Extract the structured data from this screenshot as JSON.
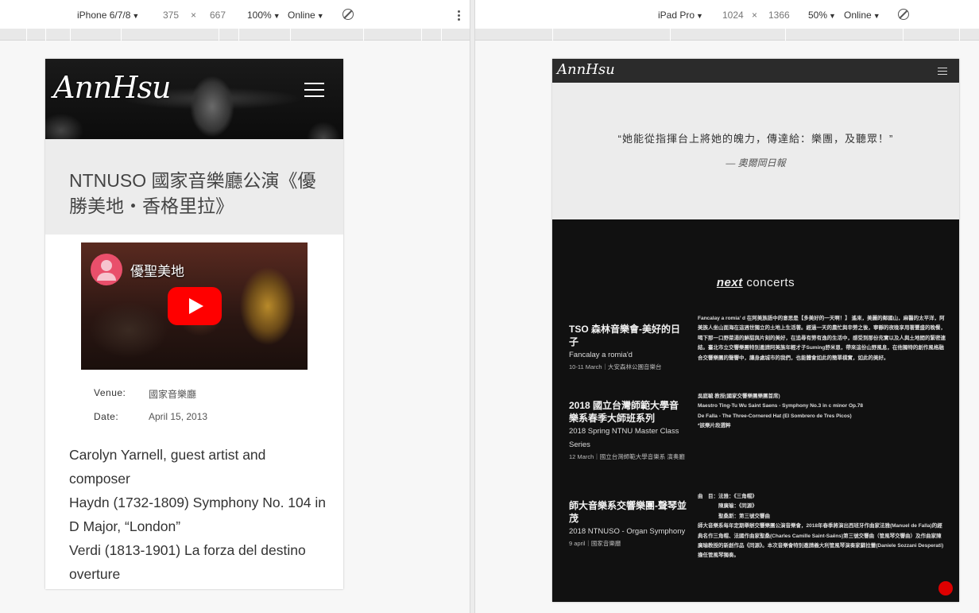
{
  "devtools": {
    "left": {
      "device": "iPhone 6/7/8",
      "width": "375",
      "height": "667",
      "times": "×",
      "zoom": "100%",
      "network": "Online"
    },
    "right": {
      "device": "iPad Pro",
      "width": "1024",
      "height": "1366",
      "times": "×",
      "zoom": "50%",
      "network": "Online"
    }
  },
  "phone": {
    "logo": "AnnHsu",
    "page_title": "NTNUSO 國家音樂廳公演《優勝美地・香格里拉》",
    "video": {
      "title": "優聖美地"
    },
    "meta": [
      {
        "label": "Venue:",
        "value": "國家音樂廳"
      },
      {
        "label": "Date:",
        "value": "April 15, 2013"
      }
    ],
    "program": [
      "Carolyn Yarnell, guest artist and composer",
      "Haydn (1732-1809) Symphony No. 104 in D Major, “London”",
      "Verdi (1813-1901) La forza del destino overture"
    ]
  },
  "ipad": {
    "logo": "AnnHsu",
    "quote": "“她能從指揮台上將她的魄力，傳達給：樂團，及聽眾！”",
    "quote_source": "— 奧爾岡日報",
    "next_em": "next",
    "next_rest": " concerts",
    "events": [
      {
        "title": "TSO 森林音樂會-美好的日子",
        "subtitle": "Fancalay a romia'd",
        "date": "10-11 March｜大安森林公園音樂台",
        "desc": "Fancalay a romia’ d 在阿美族語中的意思是【多美好的一天啊！】 遙來，美麗的鄰國山，麻醫的太平洋，阿美族人坐山面海在這週世獨立的土地上生活著。經過一天的農忙與辛勞之後，寧靜的夜晚享用著豐盛的晚餐，喝下那一口野菜湯的鮮甜與片刻的美好，在追尋有勞有逸的生活中，感受到那份充實以及人與土地間的緊密連結。臺北市立交響樂團特別邀請阿美族年輕才子Suming舒米恩，帶來這份山野風息，在他獨特的創作風格融合交響樂團的聲響中，讓身處城市的我們，也能體會如此的簡單樸實，如此的美好。"
      },
      {
        "title": "2018 國立台灣師範大學音樂系春季大師班系列",
        "subtitle": "2018 Spring NTNU Master Class Series",
        "date": "12 March｜國立台灣師範大學音樂系 演奏廳",
        "desc": "吳庭毓 教授(國家交響樂團樂團首席)\nMaestro Ting-Tu Wu Saint Saens - Symphony No.3 in c minor Op.78\nDe Falla - The Three-Cornered Hat (El Sombrero de Tres Picos)\n*該樂片段選粹"
      },
      {
        "title": "師大音樂系交響樂團-聲琴並茂",
        "subtitle": "2018 NTNUSO - Organ Symphony",
        "date": "9 april｜國家音樂廳",
        "desc": "曲　目：法雅：《三角帽》\n　　　　陳廣瑜：《同源》\n　　　　聖桑斯：第三號交響曲\n師大音樂系每年定期舉辦交響樂團公演音樂會，2018年春季將演出西班牙作曲家法雅(Manuel de Falla)的經典名作三角帽、法國作曲家聖桑(Charles Camille Saint-Saëns)第三號交響曲（管風琴交響曲）及作曲家陳廣瑜教授的新創作品《同源》。本次音樂會特別邀請義大利管風琴演奏家蘇拉蕾(Daniele Sozzani Desperati)擔任管風琴獨奏。"
      }
    ]
  }
}
